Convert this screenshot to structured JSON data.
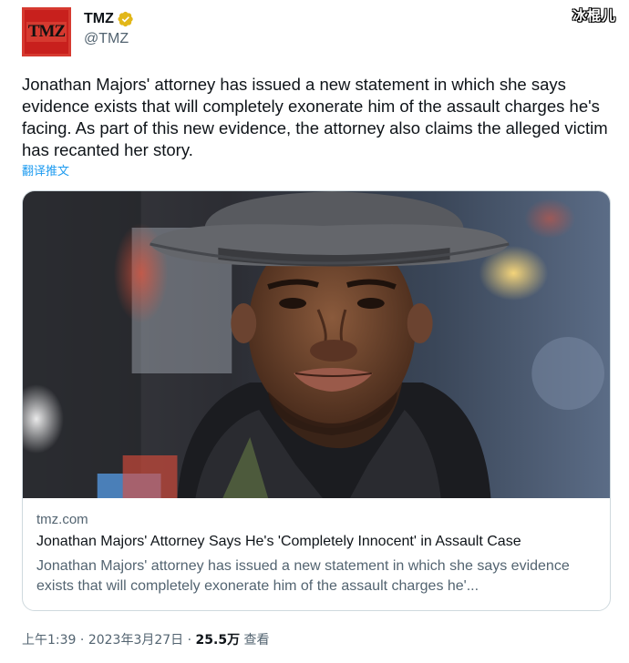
{
  "watermark": "冰棍儿",
  "author": {
    "avatar_text": "TMZ",
    "display_name": "TMZ",
    "handle": "@TMZ",
    "verified_color": "#e2b719"
  },
  "tweet": {
    "text": "Jonathan Majors' attorney has issued a new statement in which she says evidence exists that will completely exonerate him of the assault charges he's facing. As part of this new evidence, the attorney also claims the alleged victim has recanted her story.",
    "translate_label": "翻译推文"
  },
  "card": {
    "image_icon": "photo-of-man-in-hat",
    "domain": "tmz.com",
    "title": "Jonathan Majors' Attorney Says He's 'Completely Innocent' in Assault Case",
    "description": "Jonathan Majors' attorney has issued a new statement in which she says evidence exists that will completely exonerate him of the assault charges he'..."
  },
  "meta": {
    "time": "上午1:39",
    "date": "2023年3月27日",
    "views_count": "25.5万",
    "views_label": "查看"
  },
  "colors": {
    "link": "#1d9bf0",
    "secondary_text": "#536471",
    "brand_red": "#c8201d"
  }
}
